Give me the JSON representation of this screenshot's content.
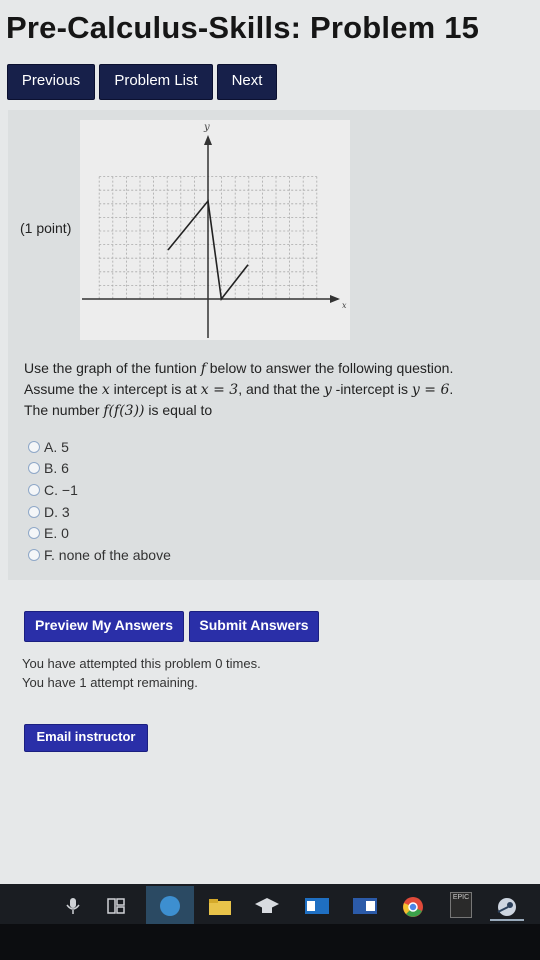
{
  "header": {
    "title": "Pre-Calculus-Skills: Problem 15"
  },
  "nav": {
    "previous": "Previous",
    "problem_list": "Problem List",
    "next": "Next"
  },
  "problem": {
    "points": "(1 point)",
    "graph": {
      "y_label": "y",
      "x_label": "x",
      "vertices": [
        [
          -3,
          3
        ],
        [
          0,
          6
        ],
        [
          1,
          0
        ],
        [
          3,
          2.1
        ]
      ]
    },
    "question": {
      "line1_pre": "Use the graph of the funtion ",
      "line1_var": "f",
      "line1_post": " below to answer the following question.",
      "line2_a": "Assume the ",
      "line2_var_x": "x",
      "line2_b": " intercept is at ",
      "line2_eq_x": "x = 3",
      "line2_c": ", and that the ",
      "line2_var_y": "y",
      "line2_d": " -intercept is ",
      "line2_eq_y": "y = 6",
      "line2_e": ".",
      "line3_pre": "The number ",
      "line3_expr": "f(f(3))",
      "line3_post": " is equal to"
    },
    "choices": [
      {
        "label": "A. 5"
      },
      {
        "label": "B. 6"
      },
      {
        "label": "C. −1"
      },
      {
        "label": "D. 3"
      },
      {
        "label": "E. 0"
      },
      {
        "label": "F. none of the above"
      }
    ]
  },
  "actions": {
    "preview": "Preview My Answers",
    "submit": "Submit Answers"
  },
  "attempts": {
    "line1": "You have attempted this problem 0 times.",
    "line2": "You have 1 attempt remaining."
  },
  "email": {
    "label": "Email instructor"
  },
  "taskbar": {
    "epic_label": "EPIC"
  },
  "colors": {
    "button_dark": "#17204a",
    "button_blue": "#2a2fa8",
    "taskbar": "#1a1d22"
  }
}
